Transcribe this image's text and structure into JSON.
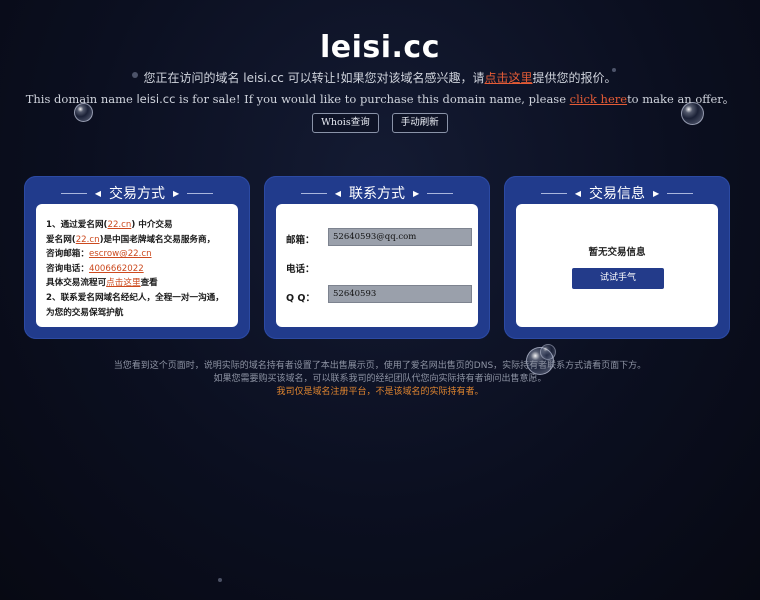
{
  "header": {
    "title": "leisi.cc",
    "cn_prefix": "您正在访问的域名 leisi.cc 可以转让!如果您对该域名感兴趣，请",
    "cn_link": "点击这里",
    "cn_suffix": "提供您的报价。",
    "en_prefix": "This domain name ",
    "en_domain": "leisi.cc",
    "en_middle": " is for sale! If you would like to purchase this domain name, please ",
    "en_link": "click here",
    "en_suffix": "to make an offer。",
    "buttons": {
      "whois": "Whois查询",
      "refresh": "手动刷新"
    }
  },
  "panels": {
    "deal": {
      "title": "交易方式",
      "line1_prefix": "1、通过爱名网(",
      "line1_link": "22.cn",
      "line1_suffix": ") 中介交易",
      "line2_prefix": "爱名网(",
      "line2_link": "22.cn",
      "line2_suffix": ")是中国老牌域名交易服务商，",
      "email_label": "咨询邮箱：",
      "email_value": "escrow@22.cn",
      "phone_label": "咨询电话：",
      "phone_value": "4006662022",
      "flow_prefix": "具体交易流程可",
      "flow_link": "点击这里",
      "flow_suffix": "查看",
      "line3": "2、联系爱名网域名经纪人，全程一对一沟通，为您的交易保驾护航"
    },
    "contact": {
      "title": "联系方式",
      "email_label": "邮箱：",
      "email_value": "52640593@qq.com",
      "phone_label": "电话：",
      "qq_label": "Q Q：",
      "qq_value": "52640593"
    },
    "info": {
      "title": "交易信息",
      "notice": "暂无交易信息",
      "button": "试试手气"
    }
  },
  "footer": {
    "line1": "当您看到这个页面时，说明实际的域名持有者设置了本出售展示页，使用了爱名网出售页的DNS，实际持有者联系方式请看页面下方。",
    "line2": "如果您需要购买该域名，可以联系我司的经纪团队代您向实际持有者询问出售意愿。",
    "line3": "我司仅是域名注册平台，不是该域名的实际持有者。"
  },
  "colors": {
    "panel": "#213b8c",
    "link": "#e35b36",
    "note": "#e0852f",
    "background": "#0b0f20"
  }
}
